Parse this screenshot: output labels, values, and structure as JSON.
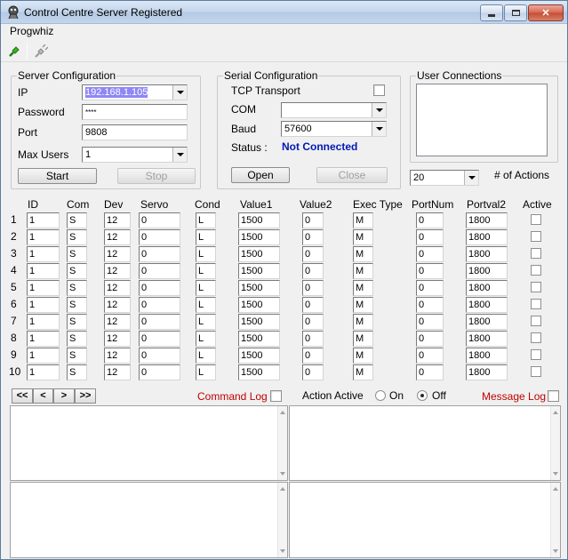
{
  "window": {
    "title": "Control Centre Server Registered"
  },
  "menu": {
    "items": [
      "Progwhiz"
    ]
  },
  "toolbar": {
    "icons": [
      "connect-plug-icon",
      "disconnect-plug-icon"
    ]
  },
  "server": {
    "group_label": "Server Configuration",
    "ip_label": "IP",
    "ip_value": "192.168.1.105",
    "password_label": "Password",
    "password_value": "****",
    "port_label": "Port",
    "port_value": "9808",
    "maxusers_label": "Max Users",
    "maxusers_value": "1",
    "start_label": "Start",
    "stop_label": "Stop"
  },
  "serial": {
    "group_label": "Serial Configuration",
    "tcp_label": "TCP Transport",
    "com_label": "COM",
    "com_value": "",
    "baud_label": "Baud",
    "baud_value": "57600",
    "status_label": "Status :",
    "status_value": "Not Connected",
    "open_label": "Open",
    "close_label": "Close"
  },
  "users": {
    "group_label": "User Connections",
    "actions_count": "20",
    "actions_label": "# of Actions"
  },
  "grid": {
    "headers": [
      "ID",
      "Com",
      "Dev",
      "Servo",
      "Cond",
      "Value1",
      "Value2",
      "Exec Type",
      "PortNum",
      "Portval2",
      "Active"
    ],
    "rows": [
      {
        "num": "1",
        "id": "1",
        "com": "S",
        "dev": "12",
        "servo": "0",
        "cond": "L",
        "value1": "1500",
        "value2": "0",
        "exec": "M",
        "portnum": "0",
        "portval2": "1800"
      },
      {
        "num": "2",
        "id": "1",
        "com": "S",
        "dev": "12",
        "servo": "0",
        "cond": "L",
        "value1": "1500",
        "value2": "0",
        "exec": "M",
        "portnum": "0",
        "portval2": "1800"
      },
      {
        "num": "3",
        "id": "1",
        "com": "S",
        "dev": "12",
        "servo": "0",
        "cond": "L",
        "value1": "1500",
        "value2": "0",
        "exec": "M",
        "portnum": "0",
        "portval2": "1800"
      },
      {
        "num": "4",
        "id": "1",
        "com": "S",
        "dev": "12",
        "servo": "0",
        "cond": "L",
        "value1": "1500",
        "value2": "0",
        "exec": "M",
        "portnum": "0",
        "portval2": "1800"
      },
      {
        "num": "5",
        "id": "1",
        "com": "S",
        "dev": "12",
        "servo": "0",
        "cond": "L",
        "value1": "1500",
        "value2": "0",
        "exec": "M",
        "portnum": "0",
        "portval2": "1800"
      },
      {
        "num": "6",
        "id": "1",
        "com": "S",
        "dev": "12",
        "servo": "0",
        "cond": "L",
        "value1": "1500",
        "value2": "0",
        "exec": "M",
        "portnum": "0",
        "portval2": "1800"
      },
      {
        "num": "7",
        "id": "1",
        "com": "S",
        "dev": "12",
        "servo": "0",
        "cond": "L",
        "value1": "1500",
        "value2": "0",
        "exec": "M",
        "portnum": "0",
        "portval2": "1800"
      },
      {
        "num": "8",
        "id": "1",
        "com": "S",
        "dev": "12",
        "servo": "0",
        "cond": "L",
        "value1": "1500",
        "value2": "0",
        "exec": "M",
        "portnum": "0",
        "portval2": "1800"
      },
      {
        "num": "9",
        "id": "1",
        "com": "S",
        "dev": "12",
        "servo": "0",
        "cond": "L",
        "value1": "1500",
        "value2": "0",
        "exec": "M",
        "portnum": "0",
        "portval2": "1800"
      },
      {
        "num": "10",
        "id": "1",
        "com": "S",
        "dev": "12",
        "servo": "0",
        "cond": "L",
        "value1": "1500",
        "value2": "0",
        "exec": "M",
        "portnum": "0",
        "portval2": "1800"
      }
    ]
  },
  "controls": {
    "nav_first": "<<",
    "nav_prev": "<",
    "nav_next": ">",
    "nav_last": ">>",
    "command_log_label": "Command  Log",
    "action_active_label": "Action Active",
    "on_label": "On",
    "off_label": "Off",
    "selected": "Off",
    "message_log_label": "Message Log"
  },
  "colors": {
    "accent_blue": "#0019b8",
    "log_red": "#c00000",
    "ip_highlight": "#8f86f6"
  }
}
